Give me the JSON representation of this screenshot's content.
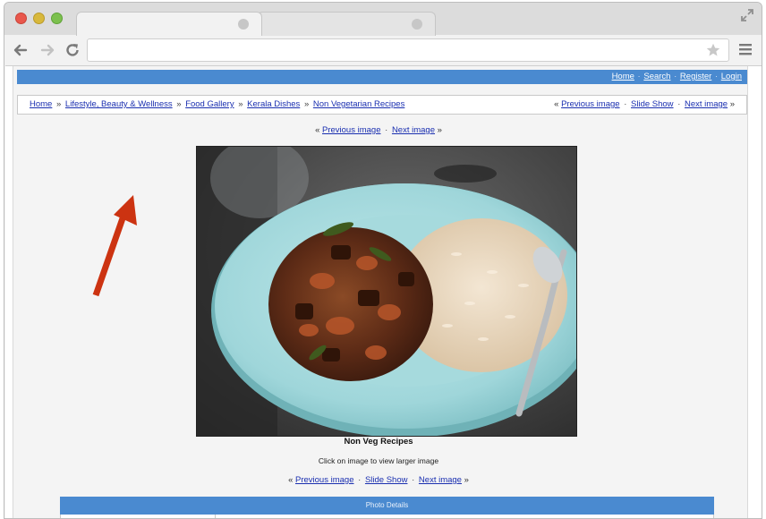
{
  "browser": {
    "tab_active_title": "",
    "tab_inactive_title": "",
    "url": ""
  },
  "topbar": {
    "links": [
      "Home",
      "Search",
      "Register",
      "Login"
    ],
    "separator": "·"
  },
  "breadcrumb": {
    "items": [
      "Home",
      "Lifestyle, Beauty & Wellness",
      "Food Gallery",
      "Kerala Dishes",
      "Non Vegetarian Recipes"
    ],
    "separator": "»"
  },
  "breadcrumb_nav": {
    "prefix": "«",
    "previous": "Previous image",
    "slideshow": "Slide Show",
    "next": "Next image",
    "suffix": "»",
    "separator": "·"
  },
  "image_nav_top": {
    "prefix": "«",
    "previous": "Previous image",
    "next": "Next image",
    "suffix": "»",
    "separator": "·"
  },
  "photo": {
    "caption": "Non Veg Recipes",
    "hint": "Click on image to view larger image"
  },
  "image_nav_bottom": {
    "prefix": "«",
    "previous": "Previous image",
    "slideshow": "Slide Show",
    "next": "Next image",
    "suffix": "»",
    "separator": "·"
  },
  "details": {
    "header": "Photo Details"
  },
  "colors": {
    "accent_bar": "#4a8ad0",
    "link": "#1a2fb0",
    "annotation_arrow": "#cc3311"
  }
}
